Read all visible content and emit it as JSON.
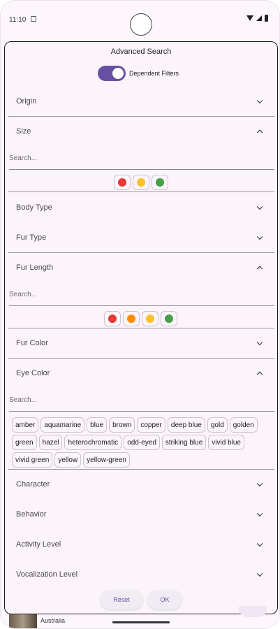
{
  "status": {
    "time": "11:10"
  },
  "dialog": {
    "title": "Advanced Search",
    "toggle_label": "Dependent Filters",
    "toggle_on": true
  },
  "sections": {
    "origin": "Origin",
    "size": "Size",
    "body_type": "Body Type",
    "fur_type": "Fur Type",
    "fur_length": "Fur Length",
    "fur_color": "Fur Color",
    "eye_color": "Eye Color",
    "character": "Character",
    "behavior": "Behavior",
    "activity_level": "Activity Level",
    "vocalization_level": "Vocalization Level"
  },
  "search_placeholder": "Search...",
  "size_colors": [
    "#e53935",
    "#fbc02d",
    "#43a047"
  ],
  "fur_length_colors": [
    "#e53935",
    "#fb8c00",
    "#fbc02d",
    "#43a047"
  ],
  "eye_colors": [
    "amber",
    "aquamarine",
    "blue",
    "brown",
    "copper",
    "deep blue",
    "gold",
    "golden",
    "green",
    "hazel",
    "heterochromatic",
    "odd-eyed",
    "striking blue",
    "vivid blue",
    "vivid green",
    "yellow",
    "yellow-green"
  ],
  "buttons": {
    "reset": "Reset",
    "ok": "OK"
  },
  "background": {
    "country": "Australia"
  }
}
